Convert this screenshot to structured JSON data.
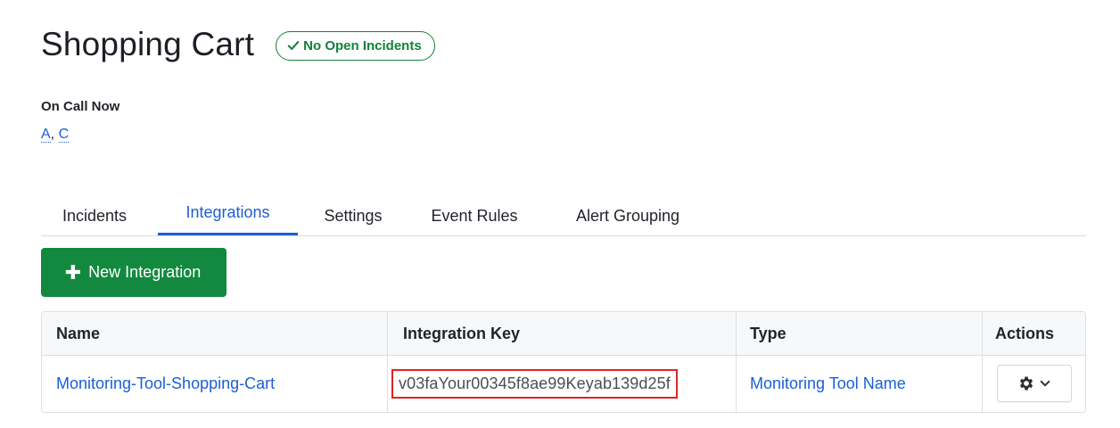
{
  "service": {
    "title": "Shopping Cart",
    "status_badge": "No Open Incidents"
  },
  "on_call": {
    "label": "On Call Now",
    "users": [
      "A",
      "C"
    ],
    "separator": ","
  },
  "tabs": [
    {
      "label": "Incidents",
      "active": false
    },
    {
      "label": "Integrations",
      "active": true
    },
    {
      "label": "Settings",
      "active": false
    },
    {
      "label": "Event Rules",
      "active": false
    },
    {
      "label": "Alert Grouping",
      "active": false
    }
  ],
  "new_integration_button": {
    "label": "New Integration",
    "icon": "plus-icon"
  },
  "table": {
    "headers": [
      "Name",
      "Integration Key",
      "Type",
      "Actions"
    ],
    "rows": [
      {
        "name": "Monitoring-Tool-Shopping-Cart",
        "integration_key": "v03faYour00345f8ae99Keyab139d25f",
        "type": "Monitoring Tool Name",
        "actions_icon": "gear-icon"
      }
    ]
  },
  "colors": {
    "accent": "#1a5fd6",
    "success": "#12893f",
    "highlight_border": "#e02424"
  }
}
